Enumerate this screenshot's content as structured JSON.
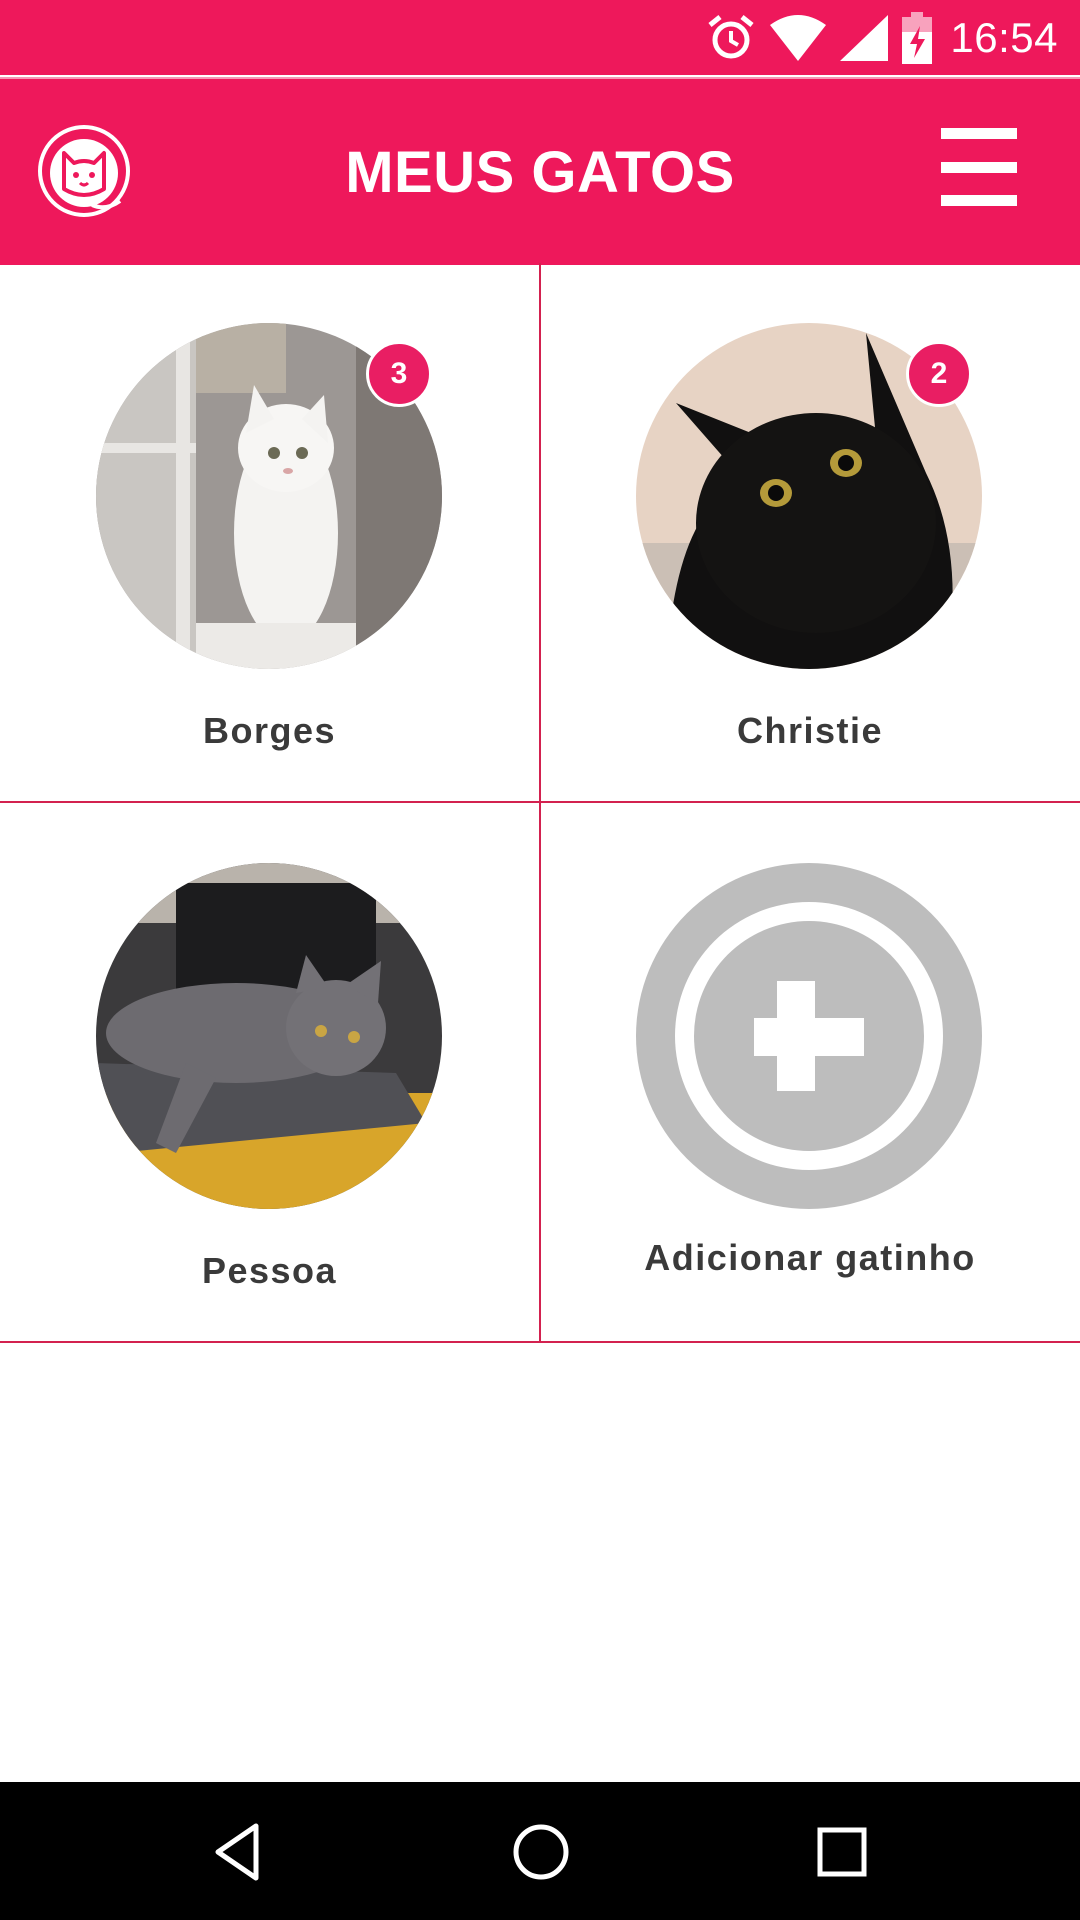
{
  "status_bar": {
    "time": "16:54",
    "icons": [
      "alarm-icon",
      "wifi-icon",
      "cellular-signal-icon",
      "battery-charging-icon"
    ]
  },
  "app_bar": {
    "title": "MEUS GATOS",
    "logo_icon": "cat-logo-icon",
    "menu_icon": "hamburger-menu-icon"
  },
  "colors": {
    "primary": "#ee185b",
    "badge": "#e91e63",
    "divider": "#d3214f",
    "add_gray": "#bdbdbd",
    "label_text": "#3a3a3a"
  },
  "cats": [
    {
      "name": "Borges",
      "badge": "3",
      "photo": "white-cat-photo"
    },
    {
      "name": "Christie",
      "badge": "2",
      "photo": "black-cat-photo"
    },
    {
      "name": "Pessoa",
      "photo": "gray-cat-photo"
    }
  ],
  "add_cat": {
    "label": "Adicionar gatinho",
    "icon": "add-circle-icon"
  },
  "nav_bar": {
    "icons": [
      "back-icon",
      "home-icon",
      "recent-apps-icon"
    ]
  }
}
